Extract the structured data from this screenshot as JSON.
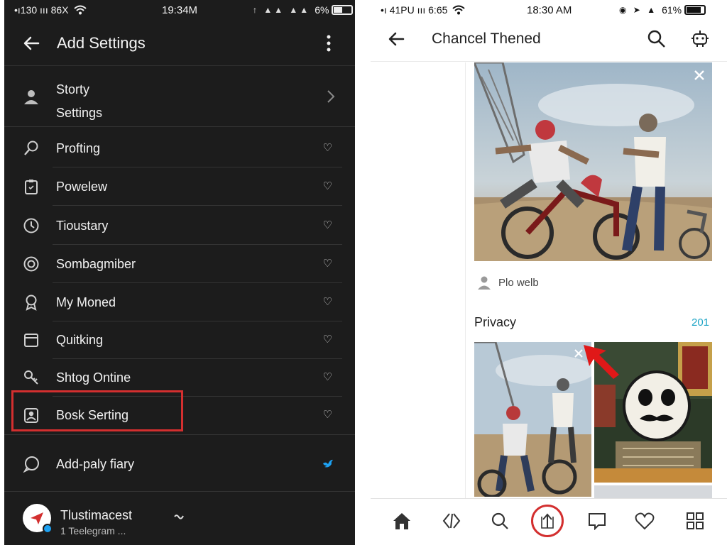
{
  "left": {
    "status": {
      "left": "•ı130 ııı 86X",
      "time": "19:34M",
      "right": "6%"
    },
    "title": "Add Settings",
    "first_item": {
      "line1": "Storty",
      "line2": "Settings"
    },
    "items": [
      {
        "label": "Profting",
        "icon": "search-icon"
      },
      {
        "label": "Powelew",
        "icon": "clipboard-icon"
      },
      {
        "label": "Tioustary",
        "icon": "clock-icon"
      },
      {
        "label": "Sombagmiber",
        "icon": "target-icon"
      },
      {
        "label": "My Moned",
        "icon": "award-icon"
      },
      {
        "label": "Quitking",
        "icon": "calendar-icon"
      },
      {
        "label": "Shtog Ontine",
        "icon": "key-icon"
      },
      {
        "label": "Bosk Serting",
        "icon": "contact-card-icon"
      }
    ],
    "special_item": {
      "label": "Add-paly fiary",
      "icon": "chat-bubble-icon"
    },
    "account": {
      "name": "Tlustimacest",
      "sub": "1 Teelegram ..."
    },
    "colors": {
      "background": "#1c1c1c",
      "highlight": "#d32f2f",
      "check": "#1da1f2"
    }
  },
  "right": {
    "status": {
      "left": "•ı 41PU ııı 6:65",
      "time": "18:30 AM",
      "right": "61%"
    },
    "title": "Chancel Thened",
    "caption": "Plo welb",
    "section": {
      "title": "Privacy",
      "count": "201"
    },
    "colors": {
      "accent": "#1fa5c6",
      "highlight": "#d32f2f",
      "arrow": "#e01818"
    }
  }
}
